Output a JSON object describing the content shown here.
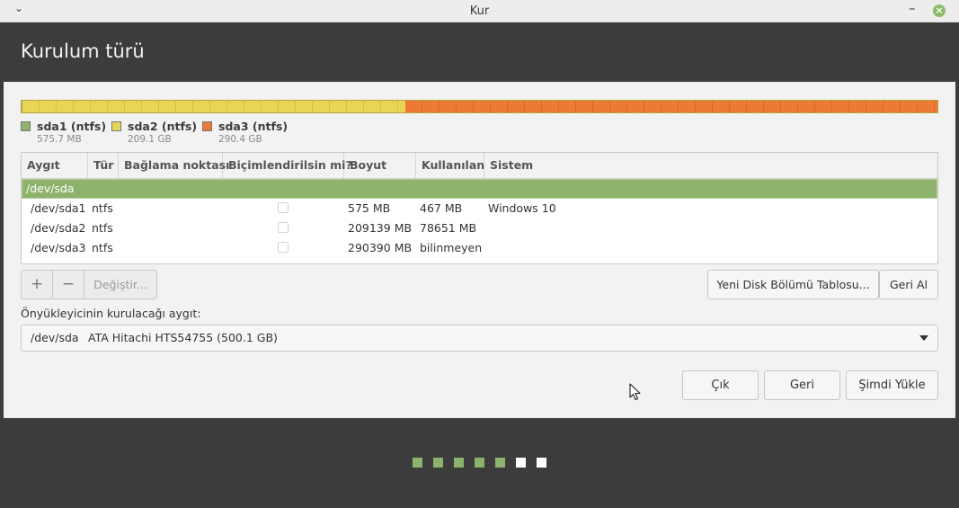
{
  "window": {
    "title": "Kur"
  },
  "header": {
    "title": "Kurulum türü"
  },
  "partition_bar": [
    {
      "name": "sda1",
      "fraction": 0.0012,
      "color": "#8db26b"
    },
    {
      "name": "sda2",
      "fraction": 0.418,
      "color": "#e8d555"
    },
    {
      "name": "sda3",
      "fraction": 0.5808,
      "color": "#ec7a34"
    }
  ],
  "legend": [
    {
      "name": "sda1 (ntfs)",
      "size": "575.7 MB",
      "color": "#8db26b"
    },
    {
      "name": "sda2 (ntfs)",
      "size": "209.1 GB",
      "color": "#e8d555"
    },
    {
      "name": "sda3 (ntfs)",
      "size": "290.4 GB",
      "color": "#ec7a34"
    }
  ],
  "table": {
    "columns": [
      "Aygıt",
      "Tür",
      "Bağlama noktası",
      "Biçimlendirilsin mi?",
      "Boyut",
      "Kullanılan",
      "Sistem"
    ],
    "disk_row": "/dev/sda",
    "rows": [
      {
        "device": "/dev/sda1",
        "type": "ntfs",
        "mount": "",
        "format": false,
        "size": "575 MB",
        "used": "467 MB",
        "system": "Windows 10"
      },
      {
        "device": "/dev/sda2",
        "type": "ntfs",
        "mount": "",
        "format": false,
        "size": "209139 MB",
        "used": "78651 MB",
        "system": ""
      },
      {
        "device": "/dev/sda3",
        "type": "ntfs",
        "mount": "",
        "format": false,
        "size": "290390 MB",
        "used": "bilinmeyen",
        "system": ""
      }
    ]
  },
  "toolbar": {
    "add": "+",
    "remove": "−",
    "change": "Değiştir...",
    "new_table": "Yeni Disk Bölümü Tablosu...",
    "revert": "Geri Al"
  },
  "bootloader": {
    "label": "Önyükleyicinin kurulacağı aygıt:",
    "device": "/dev/sda",
    "description": "ATA Hitachi HTS54755 (500.1 GB)"
  },
  "actions": {
    "quit": "Çık",
    "back": "Geri",
    "install": "Şimdi Yükle"
  },
  "progress": {
    "total_steps": 7,
    "completed_steps": 5,
    "done_color": "#8db26b",
    "pending_color": "#ffffff"
  }
}
